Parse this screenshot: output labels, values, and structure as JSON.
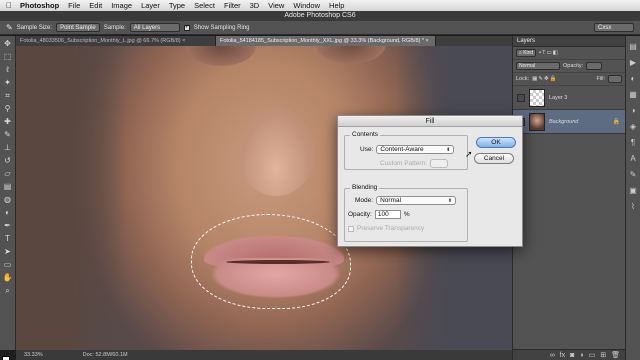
{
  "menubar": {
    "apple": "",
    "items": [
      "Photoshop",
      "File",
      "Edit",
      "Image",
      "Layer",
      "Type",
      "Select",
      "Filter",
      "3D",
      "View",
      "Window",
      "Help"
    ]
  },
  "app_title": "Adobe Photoshop CS6",
  "options": {
    "sample_size_label": "Sample Size:",
    "sample_size_value": "Point Sample",
    "sample_label": "Sample:",
    "sample_value": "All Layers",
    "show_ring_label": "Show Sampling Ring",
    "workspace": "Cxsx"
  },
  "tabs": [
    {
      "label": "Fotolia_48033506_Subscription_Monthly_L.jpg @ 66.7% (RGB/8) ×",
      "active": false
    },
    {
      "label": "Fotolia_54184185_Subscription_Monthly_XXL.jpg @ 33.3% (Background, RGB/8) * ×",
      "active": true
    }
  ],
  "status": {
    "zoom": "33.33%",
    "doc": "Doc: 52.8M/60.1M"
  },
  "layers_panel": {
    "title": "Layers",
    "kind_label": "Kind",
    "blend_mode": "Normal",
    "opacity_label": "Opacity:",
    "lock_label": "Lock:",
    "fill_label": "Fill:",
    "layers": [
      {
        "name": "Layer 3",
        "thumb": "transparent",
        "selected": false
      },
      {
        "name": "Background",
        "thumb": "photo",
        "selected": true
      }
    ]
  },
  "dialog": {
    "title": "Fill",
    "contents_label": "Contents",
    "use_label": "Use:",
    "use_value": "Content-Aware",
    "custom_pattern_label": "Custom Pattern:",
    "blending_label": "Blending",
    "mode_label": "Mode:",
    "mode_value": "Normal",
    "opacity_label": "Opacity:",
    "opacity_value": "100",
    "opacity_unit": "%",
    "preserve_label": "Preserve Transparency",
    "ok_label": "OK",
    "cancel_label": "Cancel"
  }
}
